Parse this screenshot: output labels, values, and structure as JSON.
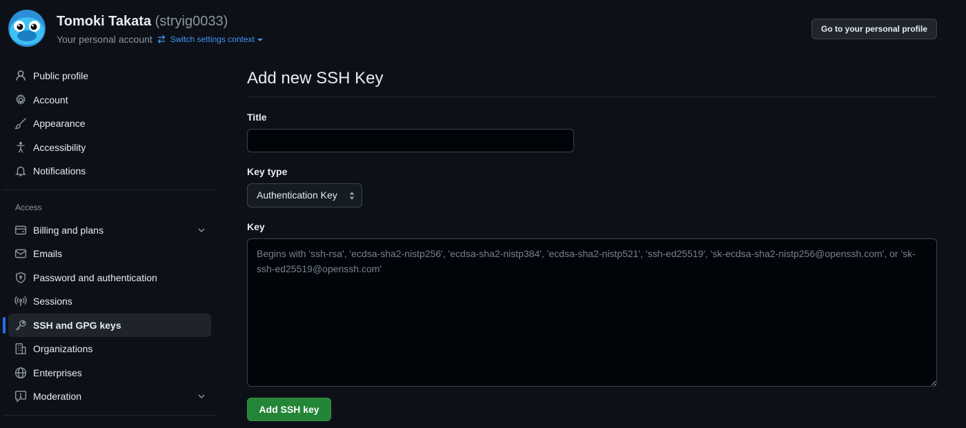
{
  "header": {
    "user_name": "Tomoki Takata",
    "user_handle": "(stryig0033)",
    "account_label": "Your personal account",
    "switch_context_label": "Switch settings context",
    "personal_profile_button": "Go to your personal profile"
  },
  "sidebar": {
    "items": [
      {
        "label": "Public profile",
        "icon": "person-icon"
      },
      {
        "label": "Account",
        "icon": "gear-icon"
      },
      {
        "label": "Appearance",
        "icon": "paintbrush-icon"
      },
      {
        "label": "Accessibility",
        "icon": "accessibility-icon"
      },
      {
        "label": "Notifications",
        "icon": "bell-icon"
      }
    ],
    "access_section_title": "Access",
    "access_items": [
      {
        "label": "Billing and plans",
        "icon": "credit-card-icon",
        "expandable": true
      },
      {
        "label": "Emails",
        "icon": "mail-icon"
      },
      {
        "label": "Password and authentication",
        "icon": "shield-lock-icon"
      },
      {
        "label": "Sessions",
        "icon": "broadcast-icon"
      },
      {
        "label": "SSH and GPG keys",
        "icon": "key-icon",
        "active": true
      },
      {
        "label": "Organizations",
        "icon": "organization-icon"
      },
      {
        "label": "Enterprises",
        "icon": "globe-icon"
      },
      {
        "label": "Moderation",
        "icon": "report-icon",
        "expandable": true
      }
    ]
  },
  "main": {
    "title": "Add new SSH Key",
    "title_field_label": "Title",
    "title_field_value": "",
    "key_type_label": "Key type",
    "key_type_value": "Authentication Key",
    "key_label": "Key",
    "key_placeholder": "Begins with 'ssh-rsa', 'ecdsa-sha2-nistp256', 'ecdsa-sha2-nistp384', 'ecdsa-sha2-nistp521', 'ssh-ed25519', 'sk-ecdsa-sha2-nistp256@openssh.com', or 'sk-ssh-ed25519@openssh.com'",
    "submit_label": "Add SSH key"
  },
  "colors": {
    "background": "#0d1117",
    "accent_blue": "#4493f8",
    "active_indicator": "#1f6feb",
    "primary_button": "#238636"
  }
}
